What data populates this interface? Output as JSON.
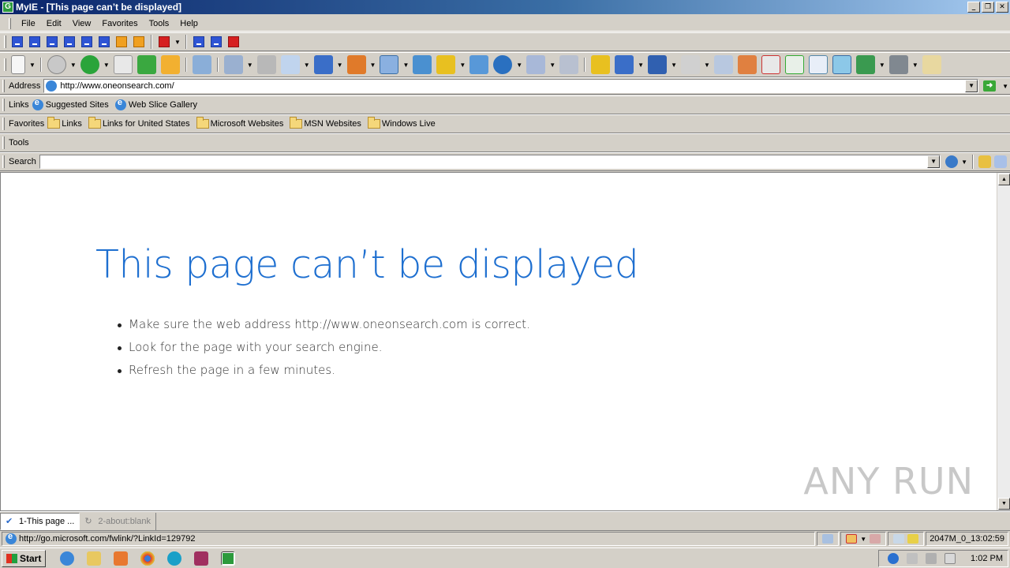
{
  "window": {
    "title": "MyIE - [This page can’t be displayed]",
    "app_icon_letter": "G"
  },
  "menu": {
    "items": [
      {
        "label": "File",
        "key": "F"
      },
      {
        "label": "Edit",
        "key": "E"
      },
      {
        "label": "View",
        "key": "V"
      },
      {
        "label": "Favorites",
        "key": "a"
      },
      {
        "label": "Tools",
        "key": "T"
      },
      {
        "label": "Help",
        "key": "H"
      }
    ]
  },
  "address_bar": {
    "label": "Address",
    "value": "http://www.oneonsearch.com/"
  },
  "links_bar": {
    "label": "Links",
    "items": [
      "Suggested Sites",
      "Web Slice Gallery"
    ]
  },
  "favorites_bar": {
    "label": "Favorites",
    "items": [
      "Links",
      "Links for United States",
      "Microsoft Websites",
      "MSN Websites",
      "Windows Live"
    ]
  },
  "tools_bar": {
    "label": "Tools"
  },
  "search_bar": {
    "label": "Search",
    "value": ""
  },
  "page": {
    "title": "This page can’t be displayed",
    "bullets": [
      "Make sure the web address http://www.oneonsearch.com is correct.",
      "Look for the page with your search engine.",
      "Refresh the page in a few minutes."
    ],
    "watermark": "ANY RUN"
  },
  "tabs": [
    {
      "label": "1-This page ...",
      "active": true
    },
    {
      "label": "2-about:blank",
      "active": false
    }
  ],
  "status": {
    "url": "http://go.microsoft.com/fwlink/?LinkId=129792",
    "info": "2047M_0_13:02:59"
  },
  "taskbar": {
    "start_label": "Start",
    "clock": "1:02 PM"
  },
  "colors": {
    "title_blue": "#1e6fd0",
    "titlebar_start": "#0a246a",
    "chrome": "#d4d0c8"
  }
}
